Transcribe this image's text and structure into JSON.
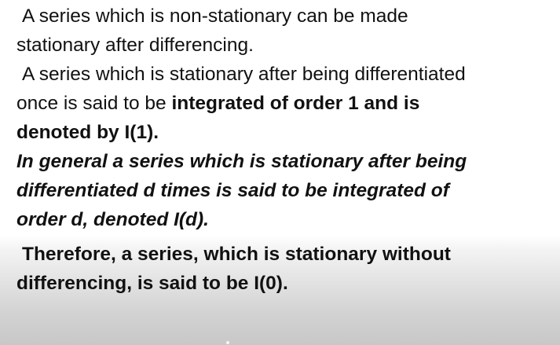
{
  "paragraph1": {
    "line1": "A series which is non-stationary can be made",
    "line2": "stationary after differencing."
  },
  "paragraph2": {
    "line1": "A series which is stationary after being differentiated",
    "line2_plain": "once is said to be ",
    "line2_bold": "integrated of order 1 and is",
    "line3_bold": "denoted by I(1)."
  },
  "paragraph3": {
    "line1": "In general a series which is stationary after being",
    "line2": "differentiated d times is said to be integrated of",
    "line3": "order d, denoted I(d)."
  },
  "paragraph4": {
    "line1": "Therefore, a series, which is stationary without",
    "line2": "differencing, is said to be I(0)."
  }
}
